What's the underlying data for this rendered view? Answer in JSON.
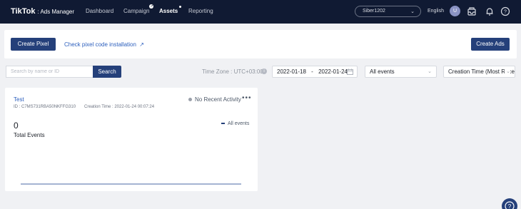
{
  "nav": {
    "brand": "TikTok",
    "brand_sub": ": Ads Manager",
    "items": [
      "Dashboard",
      "Campaign",
      "Assets",
      "Reporting"
    ],
    "account": "Siber1202",
    "language": "English",
    "avatar_initial": "U"
  },
  "toolbar": {
    "create_pixel": "Create Pixel",
    "check_install": "Check pixel code installation",
    "create_ads": "Create Ads"
  },
  "filters": {
    "search_placeholder": "Search by name or ID",
    "search_button": "Search",
    "timezone": "Time Zone : UTC+03:00",
    "date_start": "2022-01-18",
    "date_sep": "-",
    "date_end": "2022-01-24",
    "events": "All events",
    "sort": "Creation Time (Most Recent)"
  },
  "pixel": {
    "name": "Test",
    "id": "ID : C7MS731RBA50NKFFG310",
    "created": "Creation Time : 2022-01-24 00:07:24",
    "status": "No Recent Activity",
    "total": "0",
    "total_label": "Total Events",
    "legend": "All events"
  },
  "chart_data": {
    "type": "line",
    "series": [
      {
        "name": "All events",
        "values": [
          0,
          0,
          0,
          0,
          0,
          0,
          0
        ]
      }
    ]
  },
  "colors": {
    "nav_bg": "#101a33",
    "primary": "#25407a",
    "link": "#2c5fbd"
  }
}
